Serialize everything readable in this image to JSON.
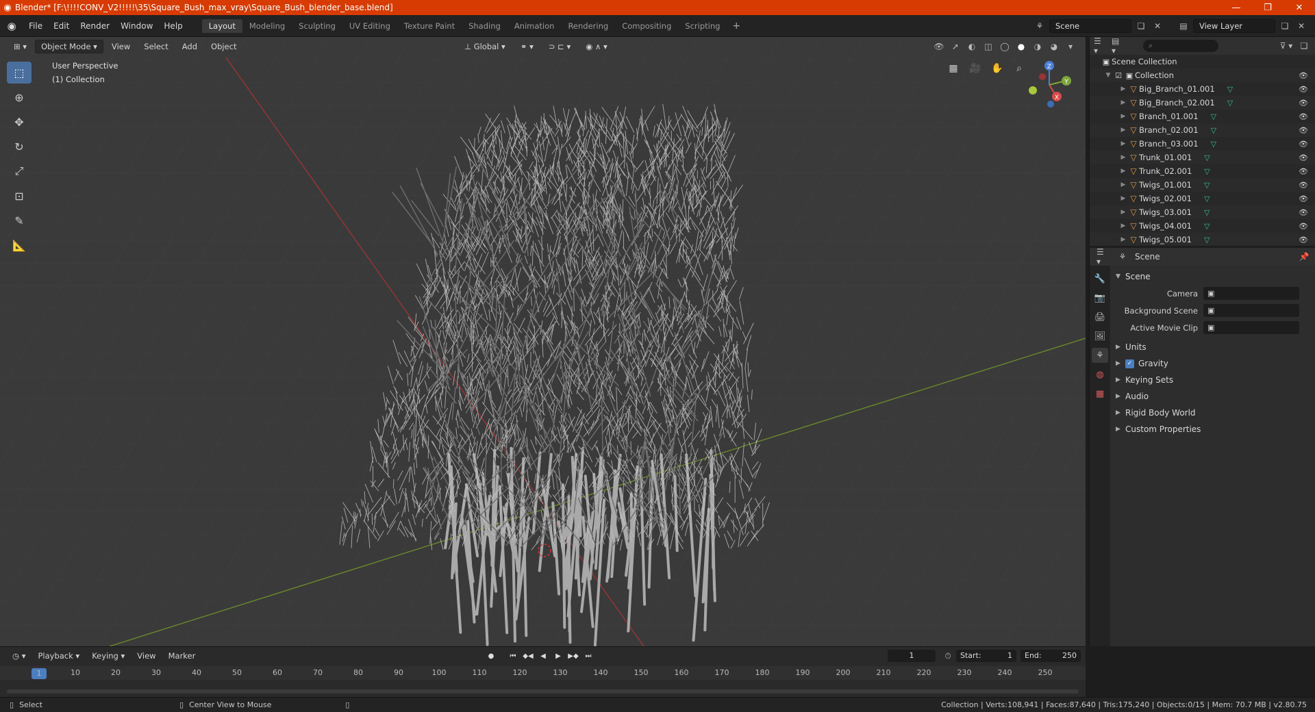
{
  "window": {
    "title": "Blender* [F:\\!!!!CONV_V2!!!!!\\35\\Square_Bush_max_vray\\Square_Bush_blender_base.blend]",
    "minimize": "—",
    "maximize": "❐",
    "close": "✕"
  },
  "menu": {
    "items": [
      "File",
      "Edit",
      "Render",
      "Window",
      "Help"
    ]
  },
  "workspaces": {
    "tabs": [
      "Layout",
      "Modeling",
      "Sculpting",
      "UV Editing",
      "Texture Paint",
      "Shading",
      "Animation",
      "Rendering",
      "Compositing",
      "Scripting"
    ],
    "active": "Layout",
    "add": "+"
  },
  "topright": {
    "scene": "Scene",
    "view_layer": "View Layer"
  },
  "viewport": {
    "mode": "Object Mode",
    "menus": [
      "View",
      "Select",
      "Add",
      "Object"
    ],
    "orientation": "Global",
    "perspective_label": "User Perspective",
    "collection_label": "(1) Collection",
    "gizmo": {
      "z": "Z",
      "y": "Y",
      "x": "X"
    }
  },
  "outliner": {
    "root": "Scene Collection",
    "collection": "Collection",
    "objects": [
      "Big_Branch_01.001",
      "Big_Branch_02.001",
      "Branch_01.001",
      "Branch_02.001",
      "Branch_03.001",
      "Trunk_01.001",
      "Trunk_02.001",
      "Twigs_01.001",
      "Twigs_02.001",
      "Twigs_03.001",
      "Twigs_04.001",
      "Twigs_05.001"
    ]
  },
  "properties": {
    "context": "Scene",
    "section": "Scene",
    "fields": [
      {
        "label": "Camera",
        "value": ""
      },
      {
        "label": "Background Scene",
        "value": ""
      },
      {
        "label": "Active Movie Clip",
        "value": ""
      }
    ],
    "subpanels": [
      "Units",
      "Gravity",
      "Keying Sets",
      "Audio",
      "Rigid Body World",
      "Custom Properties"
    ],
    "gravity_checked": true
  },
  "timeline": {
    "menus": [
      "Playback",
      "Keying",
      "View",
      "Marker"
    ],
    "current_frame": "1",
    "start_label": "Start:",
    "start": "1",
    "end_label": "End:",
    "end": "250",
    "ruler": [
      "10",
      "20",
      "30",
      "40",
      "50",
      "60",
      "70",
      "80",
      "90",
      "100",
      "110",
      "120",
      "130",
      "140",
      "150",
      "160",
      "170",
      "180",
      "190",
      "200",
      "210",
      "220",
      "230",
      "240",
      "250"
    ],
    "playhead": "1"
  },
  "statusbar": {
    "left": "Select",
    "middle": "Center View to Mouse",
    "stats": "Collection | Verts:108,941 | Faces:87,640 | Tris:175,240 | Objects:0/15 | Mem: 70.7 MB | v2.80.75"
  }
}
